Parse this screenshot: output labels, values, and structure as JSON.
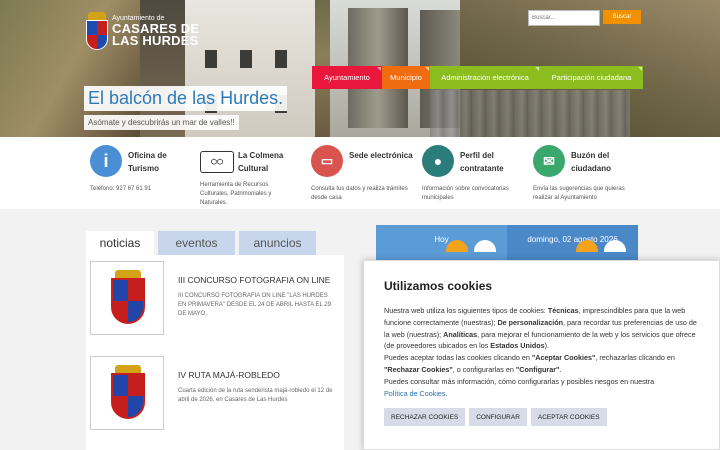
{
  "header": {
    "logo_line1": "Ayuntamiento de",
    "logo_line2": "CASARES DE",
    "logo_line3": "LAS HURDES",
    "search_placeholder": "Buscar...",
    "search_button": "Buscar"
  },
  "nav": [
    {
      "label": "Ayuntamiento",
      "color": "#e8173b"
    },
    {
      "label": "Municipio",
      "color": "#ef6c10"
    },
    {
      "label": "Administración electrónica",
      "color": "#8cbd1f"
    },
    {
      "label": "Participación ciudadana",
      "color": "#8cbd1f"
    }
  ],
  "hero": {
    "title": "El balcón de las Hurdes.",
    "subtitle": "Asómate y descubrirás un mar de valles!!"
  },
  "services": [
    {
      "title": "Oficina de Turismo",
      "desc": "Teléfono: 927 67 61 91",
      "icon": "info-icon",
      "color": "#4a8fd6"
    },
    {
      "title": "La Colmena Cultural",
      "desc": "Herramienta de Recursos Culturales, Patrimoniales y Naturales.",
      "icon": "colmena-logo-icon"
    },
    {
      "title": "Sede electrónica",
      "desc": "Consulta tus datos y realiza trámites desde casa",
      "icon": "folder-icon",
      "color": "#d9534f"
    },
    {
      "title": "Perfil del contratante",
      "desc": "Información sobre convocatorias municipales",
      "icon": "person-icon",
      "color": "#2a7d7b"
    },
    {
      "title": "Buzón del ciudadano",
      "desc": "Envía las sugerencias que quieras realizar al Ayuntamiento",
      "icon": "mail-icon",
      "color": "#3aa76d"
    }
  ],
  "tabs": [
    "noticias",
    "eventos",
    "anuncios"
  ],
  "news": [
    {
      "title": "III CONCURSO FOTOGRAFIA ON LINE",
      "desc": "III CONCURSO FOTOGRAFIA ON LINE \"LAS HURDES EN PRIMAVERA\" DESDE EL 24 DE ABRIL HASTA EL 29 DE MAYO."
    },
    {
      "title": "IV RUTA MAJÁ-ROBLEDO",
      "desc": "Cuarta edición de la ruta senderista majá-robledo el 12 de abril de 2026, en Casares de Las Hurdes"
    }
  ],
  "calendar": {
    "today_label": "Hoy",
    "date_label": "domingo, 02 agosto 2026"
  },
  "cookies": {
    "title": "Utilizamos cookies",
    "p1": "Nuestra web utiliza los siguientes tipos de cookies:",
    "t1": "Técnicas",
    "p2": ", imprescindibles para que la web funcione correctamente (nuestras);",
    "t2": "De personalización",
    "p3": ", para recordar tus preferencias de uso de la web (nuestras);",
    "t3": "Analíticas",
    "p4": ", para mejorar el funcionamiento de la web y los servicios que ofrece (de proveedores ubicados en los",
    "t4": "Estados Unidos",
    "p5": ").",
    "p6": "Puedes aceptar todas las cookies clicando en",
    "q1": "\"Aceptar Cookies\"",
    "p7": ", rechazarlas clicando en",
    "q2": "\"Rechazar Cookies\"",
    "p8": ", o configurarlas en",
    "q3": "\"Configurar\"",
    "p9": ".",
    "p10": "Puedes consultar más información, cómo configurarlas y posibles riesgos en nuestra",
    "link": "Política de Cookies",
    "p11": ".",
    "btn_reject": "RECHAZAR COOKIES",
    "btn_config": "CONFIGURAR",
    "btn_accept": "ACEPTAR COOKIES"
  }
}
